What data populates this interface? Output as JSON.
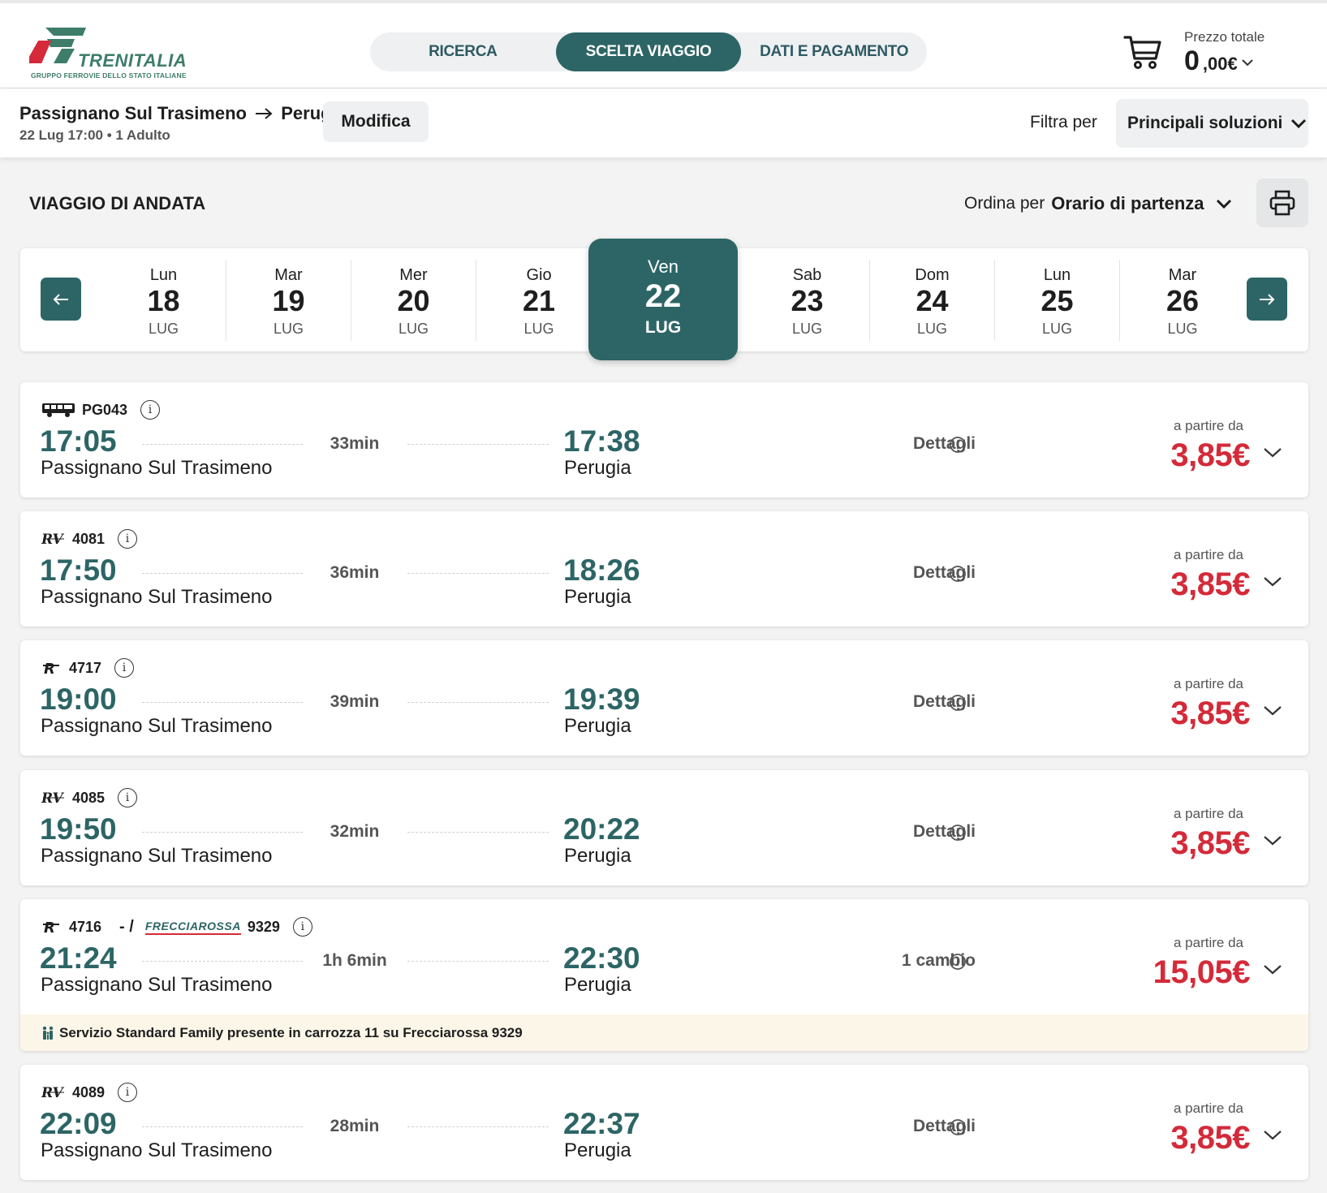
{
  "header": {
    "logo_word": "TRENITALIA",
    "logo_sub": "GRUPPO FERROVIE DELLO STATO ITALIANE",
    "steps": [
      "RICERCA",
      "SCELTA VIAGGIO",
      "DATI E PAGAMENTO"
    ],
    "active_step": "SCELTA VIAGGIO",
    "price_label": "Prezzo totale",
    "price_int": "0",
    "price_dec": ",00",
    "currency": "€"
  },
  "search": {
    "from": "Passignano Sul Trasimeno",
    "to": "Perugia",
    "summary": "22 Lug 17:00 • 1 Adulto",
    "modify_label": "Modifica",
    "filter_label": "Filtra per",
    "filter_value": "Principali soluzioni"
  },
  "section": {
    "title": "VIAGGIO DI ANDATA",
    "sort_label": "Ordina per",
    "sort_value": "Orario di partenza"
  },
  "dates": [
    {
      "dn": "Lun",
      "dd": "18",
      "dm": "LUG"
    },
    {
      "dn": "Mar",
      "dd": "19",
      "dm": "LUG"
    },
    {
      "dn": "Mer",
      "dd": "20",
      "dm": "LUG"
    },
    {
      "dn": "Gio",
      "dd": "21",
      "dm": "LUG"
    },
    {
      "dn": "Ven",
      "dd": "22",
      "dm": "LUG"
    },
    {
      "dn": "Sab",
      "dd": "23",
      "dm": "LUG"
    },
    {
      "dn": "Dom",
      "dd": "24",
      "dm": "LUG"
    },
    {
      "dn": "Lun",
      "dd": "25",
      "dm": "LUG"
    },
    {
      "dn": "Mar",
      "dd": "26",
      "dm": "LUG"
    }
  ],
  "results": [
    {
      "train": "PG043",
      "dep": "17:05",
      "from": "Passignano Sul Trasimeno",
      "dur": "33min",
      "arr": "17:38",
      "to": "Perugia",
      "detail": "Dettagli",
      "from_label": "a partire da",
      "price": "3,85€"
    },
    {
      "train": "4081",
      "dep": "17:50",
      "from": "Passignano Sul Trasimeno",
      "dur": "36min",
      "arr": "18:26",
      "to": "Perugia",
      "detail": "Dettagli",
      "from_label": "a partire da",
      "price": "3,85€"
    },
    {
      "train": "4717",
      "dep": "19:00",
      "from": "Passignano Sul Trasimeno",
      "dur": "39min",
      "arr": "19:39",
      "to": "Perugia",
      "detail": "Dettagli",
      "from_label": "a partire da",
      "price": "3,85€"
    },
    {
      "train": "4085",
      "dep": "19:50",
      "from": "Passignano Sul Trasimeno",
      "dur": "32min",
      "arr": "20:22",
      "to": "Perugia",
      "detail": "Dettagli",
      "from_label": "a partire da",
      "price": "3,85€"
    },
    {
      "train": "4716",
      "train2_brand": "FRECCIAROSSA",
      "train2": "9329",
      "dep": "21:24",
      "from": "Passignano Sul Trasimeno",
      "dur": "1h 6min",
      "arr": "22:30",
      "to": "Perugia",
      "detail": "1 cambio",
      "from_label": "a partire da",
      "price": "15,05€",
      "notice": "Servizio Standard Family presente in carrozza 11 su Frecciarossa 9329"
    },
    {
      "train": "4089",
      "dep": "22:09",
      "from": "Passignano Sul Trasimeno",
      "dur": "28min",
      "arr": "22:37",
      "to": "Perugia",
      "detail": "Dettagli",
      "from_label": "a partire da",
      "price": "3,85€"
    }
  ],
  "colors": {
    "accent": "#2d6566",
    "price": "#d42a39"
  }
}
